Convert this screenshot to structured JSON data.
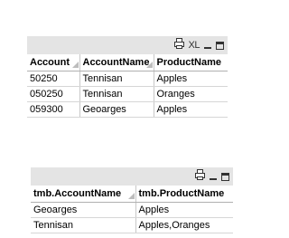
{
  "table1": {
    "icons": [
      "print-icon",
      "xl-icon",
      "minimize-icon",
      "maximize-icon"
    ],
    "xl_label": "XL",
    "columns": [
      "Account",
      "AccountName",
      "ProductName"
    ],
    "rows": [
      [
        "50250",
        "Tennisan",
        "Apples"
      ],
      [
        "050250",
        "Tennisan",
        "Oranges"
      ],
      [
        "059300",
        "Geoarges",
        "Apples"
      ]
    ]
  },
  "table2": {
    "icons": [
      "print-icon",
      "minimize-icon",
      "maximize-icon"
    ],
    "columns": [
      "tmb.AccountName",
      "tmb.ProductName"
    ],
    "rows": [
      [
        "Geoarges",
        "Apples"
      ],
      [
        "Tennisan",
        "Apples,Oranges"
      ]
    ]
  }
}
